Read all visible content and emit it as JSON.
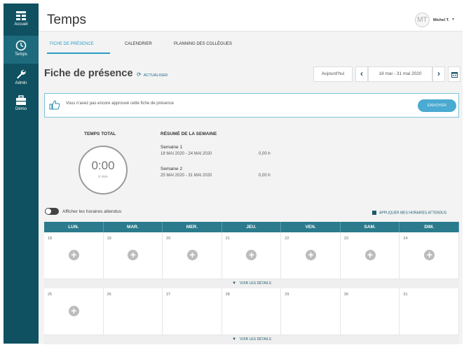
{
  "sidebar": {
    "items": [
      {
        "label": "Accueil",
        "icon": "grid-icon"
      },
      {
        "label": "Temps",
        "icon": "clock-icon"
      },
      {
        "label": "Admin",
        "icon": "wrench-icon"
      },
      {
        "label": "Démo",
        "icon": "briefcase-icon"
      }
    ],
    "active_index": 1
  },
  "header": {
    "title": "Temps",
    "avatar_initials": "MT",
    "user_name": "Michel T.",
    "user_caret": "▾"
  },
  "tabs": [
    {
      "label": "FICHE DE PRÉSENCE",
      "active": true
    },
    {
      "label": "CALENDRIER",
      "active": false
    },
    {
      "label": "PLANNING DES COLLÈGUES",
      "active": false
    }
  ],
  "page": {
    "title": "Fiche de présence",
    "refresh_label": "ACTUALISER",
    "today_label": "Aujourd'hui",
    "prev_label": "‹",
    "next_label": "›",
    "date_range": "18 mai - 31 mai 2020"
  },
  "banner": {
    "text": "Vous n'avez pas encore approuvé cette fiche de présence",
    "button_label": "ENVOYER"
  },
  "summary": {
    "total_label": "TEMPS TOTAL",
    "total_value": "0:00",
    "total_unit": "h min",
    "week_summary_title": "RÉSUMÉ DE LA SEMAINE",
    "weeks": [
      {
        "name": "Semaine 1",
        "dates": "18 MAI 2020 - 24 MAI 2020",
        "hours": "0,00 h"
      },
      {
        "name": "Semaine 2",
        "dates": "25 MAI 2020 - 31 MAI 2020",
        "hours": "0,00 h"
      }
    ]
  },
  "options": {
    "toggle_label": "Afficher les horaires attendus",
    "toggle_on": false,
    "apply_label": "APPLIQUER MES HORAIRES ATTENDUS"
  },
  "calendar": {
    "days": [
      "LUN.",
      "MAR.",
      "MER.",
      "JEU.",
      "VEN.",
      "SAM.",
      "DIM."
    ],
    "weeks": [
      {
        "dates": [
          "18",
          "19",
          "20",
          "21",
          "22",
          "23",
          "24"
        ],
        "add_buttons": [
          true,
          true,
          true,
          true,
          true,
          true,
          true
        ]
      },
      {
        "dates": [
          "25",
          "26",
          "27",
          "28",
          "29",
          "30",
          "31"
        ],
        "add_buttons": [
          true,
          false,
          false,
          false,
          false,
          false,
          false
        ]
      }
    ],
    "details_label": "VOIR LES DÉTAILS",
    "add_symbol": "+"
  },
  "colors": {
    "sidebar": "#0f5160",
    "accent": "#2a9dc4",
    "calendar_header": "#2b7b8d",
    "button": "#4aaad1"
  }
}
